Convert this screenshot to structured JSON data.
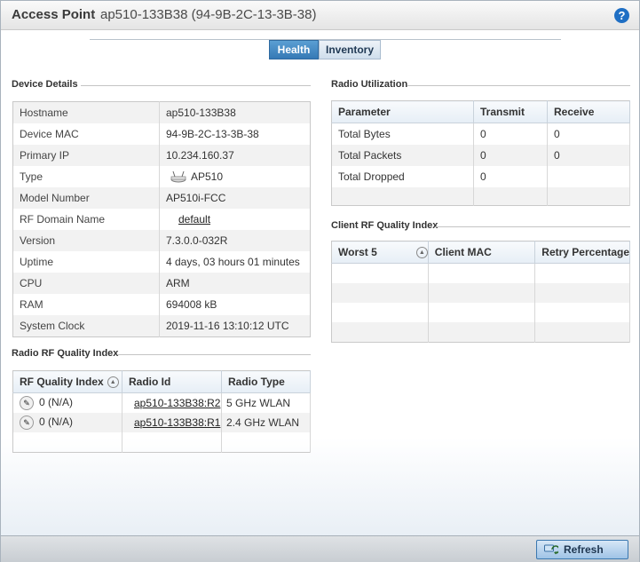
{
  "header": {
    "title": "Access Point",
    "subtitle": "ap510-133B38 (94-9B-2C-13-3B-38)"
  },
  "tabs": [
    {
      "label": "Health",
      "active": true
    },
    {
      "label": "Inventory",
      "active": false
    }
  ],
  "device_details": {
    "heading": "Device Details",
    "rows": [
      {
        "key": "Hostname",
        "value": "ap510-133B38"
      },
      {
        "key": "Device MAC",
        "value": "94-9B-2C-13-3B-38"
      },
      {
        "key": "Primary IP",
        "value": "10.234.160.37"
      },
      {
        "key": "Type",
        "value": "AP510"
      },
      {
        "key": "Model Number",
        "value": "AP510i-FCC"
      },
      {
        "key": "RF Domain Name",
        "value": "default"
      },
      {
        "key": "Version",
        "value": "7.3.0.0-032R"
      },
      {
        "key": "Uptime",
        "value": "4 days, 03 hours 01 minutes"
      },
      {
        "key": "CPU",
        "value": "ARM"
      },
      {
        "key": "RAM",
        "value": "694008 kB"
      },
      {
        "key": "System Clock",
        "value": "2019-11-16 13:10:12 UTC"
      }
    ]
  },
  "radio_rf": {
    "heading": "Radio RF Quality Index",
    "columns": [
      "RF Quality Index",
      "Radio Id",
      "Radio Type"
    ],
    "rows": [
      {
        "quality": "0 (N/A)",
        "radio_id": "ap510-133B38:R2",
        "radio_type": "5 GHz WLAN"
      },
      {
        "quality": "0 (N/A)",
        "radio_id": "ap510-133B38:R1",
        "radio_type": "2.4 GHz WLAN"
      }
    ]
  },
  "radio_util": {
    "heading": "Radio Utilization",
    "columns": [
      "Parameter",
      "Transmit",
      "Receive"
    ],
    "rows": [
      {
        "param": "Total Bytes",
        "tx": "0",
        "rx": "0"
      },
      {
        "param": "Total Packets",
        "tx": "0",
        "rx": "0"
      },
      {
        "param": "Total Dropped",
        "tx": "0",
        "rx": ""
      }
    ]
  },
  "client_rf": {
    "heading": "Client RF Quality Index",
    "columns": [
      "Worst 5",
      "Client MAC",
      "Retry Percentage"
    ]
  },
  "footer": {
    "refresh_label": "Refresh"
  },
  "colors": {
    "accent": "#3579b5",
    "help": "#1f6fc4"
  }
}
